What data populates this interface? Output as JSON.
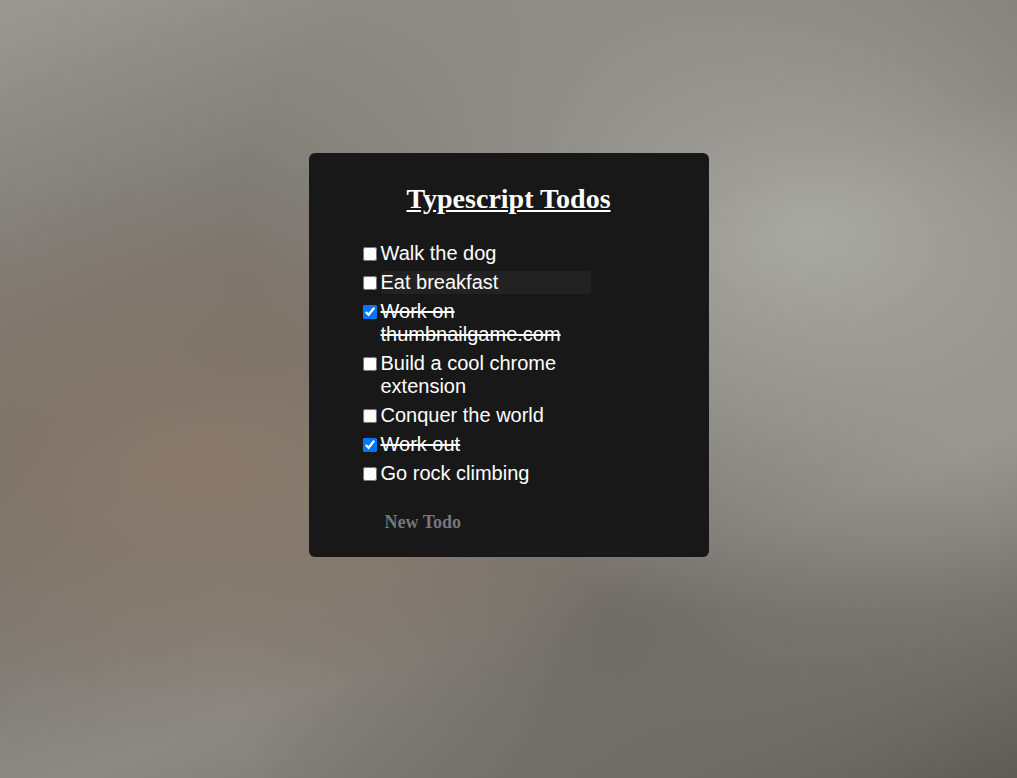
{
  "title": "Typescript Todos",
  "todos": [
    {
      "text": "Walk the dog",
      "checked": false,
      "highlighted": false
    },
    {
      "text": "Eat breakfast",
      "checked": false,
      "highlighted": true
    },
    {
      "text": "Work on thumbnailgame.com",
      "checked": true,
      "highlighted": false
    },
    {
      "text": "Build a cool chrome extension",
      "checked": false,
      "highlighted": false
    },
    {
      "text": "Conquer the world",
      "checked": false,
      "highlighted": false
    },
    {
      "text": "Work out",
      "checked": true,
      "highlighted": false
    },
    {
      "text": "Go rock climbing",
      "checked": false,
      "highlighted": false
    }
  ],
  "input": {
    "placeholder": "New Todo"
  }
}
